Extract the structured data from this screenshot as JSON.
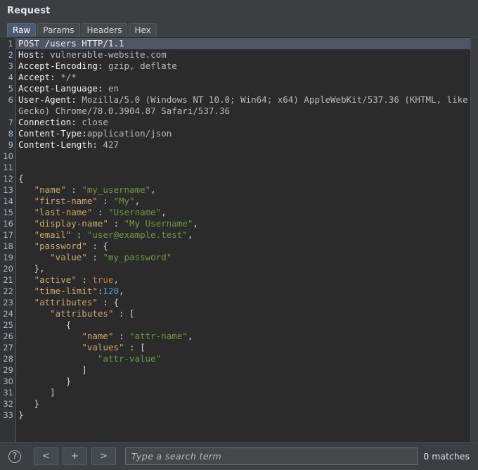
{
  "panel": {
    "title": "Request"
  },
  "tabs": [
    {
      "label": "Raw",
      "selected": true
    },
    {
      "label": "Params",
      "selected": false
    },
    {
      "label": "Headers",
      "selected": false
    },
    {
      "label": "Hex",
      "selected": false
    }
  ],
  "editor": {
    "total_lines": 33,
    "highlight_line": 1,
    "colors": {
      "background": "#2b2b2b",
      "gutter": "#313335",
      "highlight": "#4f5561",
      "key": "#cca76a",
      "string": "#6a9b41",
      "number": "#4f9fd6",
      "boolean": "#cc7832",
      "header_name": "#f2f2f2",
      "header_value": "#bbbbbb",
      "tab_selected": "#4c5a73"
    },
    "lines": [
      {
        "num": "1",
        "highlight": true,
        "tokens": [
          {
            "t": "POST /users HTTP/1.1",
            "c": "hdr-name"
          }
        ]
      },
      {
        "num": "2",
        "tokens": [
          {
            "t": "Host: ",
            "c": "hdr-name"
          },
          {
            "t": "vulnerable-website.com",
            "c": "hdr-val"
          }
        ]
      },
      {
        "num": "3",
        "tokens": [
          {
            "t": "Accept-Encoding: ",
            "c": "hdr-name"
          },
          {
            "t": "gzip, deflate",
            "c": "hdr-val"
          }
        ]
      },
      {
        "num": "4",
        "tokens": [
          {
            "t": "Accept: ",
            "c": "hdr-name"
          },
          {
            "t": "*/*",
            "c": "hdr-val"
          }
        ]
      },
      {
        "num": "5",
        "tokens": [
          {
            "t": "Accept-Language: ",
            "c": "hdr-name"
          },
          {
            "t": "en",
            "c": "hdr-val"
          }
        ]
      },
      {
        "num": "6",
        "tokens": [
          {
            "t": "User-Agent: ",
            "c": "hdr-name"
          },
          {
            "t": "Mozilla/5.0 (Windows NT 10.0; Win64; x64) AppleWebKit/537.36 (KHTML, like",
            "c": "hdr-val"
          }
        ]
      },
      {
        "num": "",
        "tokens": [
          {
            "t": "Gecko) Chrome/78.0.3904.87 Safari/537.36",
            "c": "hdr-val"
          }
        ]
      },
      {
        "num": "7",
        "tokens": [
          {
            "t": "Connection: ",
            "c": "hdr-name"
          },
          {
            "t": "close",
            "c": "hdr-val"
          }
        ]
      },
      {
        "num": "8",
        "tokens": [
          {
            "t": "Content-Type:",
            "c": "hdr-name"
          },
          {
            "t": "application/json",
            "c": "hdr-val"
          }
        ]
      },
      {
        "num": "9",
        "tokens": [
          {
            "t": "Content-Length: ",
            "c": "hdr-name"
          },
          {
            "t": "427",
            "c": "hdr-val"
          }
        ]
      },
      {
        "num": "10",
        "tokens": []
      },
      {
        "num": "11",
        "tokens": []
      },
      {
        "num": "12",
        "tokens": [
          {
            "t": "{",
            "c": "punc"
          }
        ]
      },
      {
        "num": "13",
        "tokens": [
          {
            "t": "   ",
            "c": "punc"
          },
          {
            "t": "\"name\"",
            "c": "key"
          },
          {
            "t": " : ",
            "c": "punc"
          },
          {
            "t": "\"my_username\"",
            "c": "str"
          },
          {
            "t": ",",
            "c": "punc"
          }
        ]
      },
      {
        "num": "14",
        "tokens": [
          {
            "t": "   ",
            "c": "punc"
          },
          {
            "t": "\"first-name\"",
            "c": "key"
          },
          {
            "t": " : ",
            "c": "punc"
          },
          {
            "t": "\"My\"",
            "c": "str"
          },
          {
            "t": ",",
            "c": "punc"
          }
        ]
      },
      {
        "num": "15",
        "tokens": [
          {
            "t": "   ",
            "c": "punc"
          },
          {
            "t": "\"last-name\"",
            "c": "key"
          },
          {
            "t": " : ",
            "c": "punc"
          },
          {
            "t": "\"Username\"",
            "c": "str"
          },
          {
            "t": ",",
            "c": "punc"
          }
        ]
      },
      {
        "num": "16",
        "tokens": [
          {
            "t": "   ",
            "c": "punc"
          },
          {
            "t": "\"display-name\"",
            "c": "key"
          },
          {
            "t": " : ",
            "c": "punc"
          },
          {
            "t": "\"My Username\"",
            "c": "str"
          },
          {
            "t": ",",
            "c": "punc"
          }
        ]
      },
      {
        "num": "17",
        "tokens": [
          {
            "t": "   ",
            "c": "punc"
          },
          {
            "t": "\"email\"",
            "c": "key"
          },
          {
            "t": " : ",
            "c": "punc"
          },
          {
            "t": "\"user@example.test\"",
            "c": "str"
          },
          {
            "t": ",",
            "c": "punc"
          }
        ]
      },
      {
        "num": "18",
        "tokens": [
          {
            "t": "   ",
            "c": "punc"
          },
          {
            "t": "\"password\"",
            "c": "key"
          },
          {
            "t": " : {",
            "c": "punc"
          }
        ]
      },
      {
        "num": "19",
        "tokens": [
          {
            "t": "      ",
            "c": "punc"
          },
          {
            "t": "\"value\"",
            "c": "key"
          },
          {
            "t": " : ",
            "c": "punc"
          },
          {
            "t": "\"my_password\"",
            "c": "str"
          }
        ]
      },
      {
        "num": "20",
        "tokens": [
          {
            "t": "   },",
            "c": "punc"
          }
        ]
      },
      {
        "num": "21",
        "tokens": [
          {
            "t": "   ",
            "c": "punc"
          },
          {
            "t": "\"active\"",
            "c": "key"
          },
          {
            "t": " : ",
            "c": "punc"
          },
          {
            "t": "true",
            "c": "bool"
          },
          {
            "t": ",",
            "c": "punc"
          }
        ]
      },
      {
        "num": "22",
        "tokens": [
          {
            "t": "   ",
            "c": "punc"
          },
          {
            "t": "\"time-limit\"",
            "c": "key"
          },
          {
            "t": ":",
            "c": "punc"
          },
          {
            "t": "120",
            "c": "num"
          },
          {
            "t": ",",
            "c": "punc"
          }
        ]
      },
      {
        "num": "23",
        "tokens": [
          {
            "t": "   ",
            "c": "punc"
          },
          {
            "t": "\"attributes\"",
            "c": "key"
          },
          {
            "t": " : {",
            "c": "punc"
          }
        ]
      },
      {
        "num": "24",
        "tokens": [
          {
            "t": "      ",
            "c": "punc"
          },
          {
            "t": "\"attributes\"",
            "c": "key"
          },
          {
            "t": " : [",
            "c": "punc"
          }
        ]
      },
      {
        "num": "25",
        "tokens": [
          {
            "t": "         {",
            "c": "punc"
          }
        ]
      },
      {
        "num": "26",
        "tokens": [
          {
            "t": "            ",
            "c": "punc"
          },
          {
            "t": "\"name\"",
            "c": "key"
          },
          {
            "t": " : ",
            "c": "punc"
          },
          {
            "t": "\"attr-name\"",
            "c": "str"
          },
          {
            "t": ",",
            "c": "punc"
          }
        ]
      },
      {
        "num": "27",
        "tokens": [
          {
            "t": "            ",
            "c": "punc"
          },
          {
            "t": "\"values\"",
            "c": "key"
          },
          {
            "t": " : [",
            "c": "punc"
          }
        ]
      },
      {
        "num": "28",
        "tokens": [
          {
            "t": "               ",
            "c": "punc"
          },
          {
            "t": "\"attr-value\"",
            "c": "str"
          }
        ]
      },
      {
        "num": "29",
        "tokens": [
          {
            "t": "            ]",
            "c": "punc"
          }
        ]
      },
      {
        "num": "30",
        "tokens": [
          {
            "t": "         }",
            "c": "punc"
          }
        ]
      },
      {
        "num": "31",
        "tokens": [
          {
            "t": "      ]",
            "c": "punc"
          }
        ]
      },
      {
        "num": "32",
        "tokens": [
          {
            "t": "   }",
            "c": "punc"
          }
        ]
      },
      {
        "num": "33",
        "tokens": [
          {
            "t": "}",
            "c": "punc"
          }
        ]
      }
    ]
  },
  "footer": {
    "help_icon": "question-circle-icon",
    "help_label": "?",
    "prev_label": "<",
    "add_label": "+",
    "next_label": ">",
    "search_placeholder": "Type a search term",
    "search_value": "",
    "matches_label": "0 matches"
  }
}
